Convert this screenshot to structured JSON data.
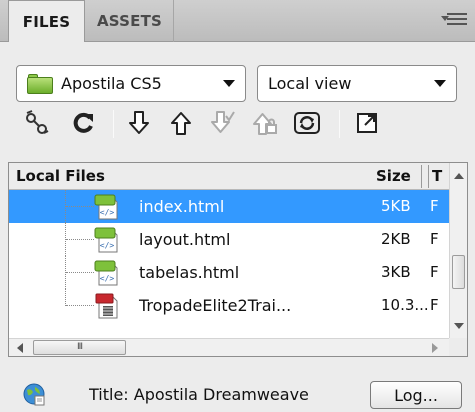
{
  "tabs": [
    {
      "label": "FILES",
      "active": true
    },
    {
      "label": "ASSETS",
      "active": false
    }
  ],
  "site_select": {
    "value": "Apostila CS5",
    "icon": "folder-icon"
  },
  "view_select": {
    "value": "Local view"
  },
  "toolbar": {
    "icons": [
      "connect-icon",
      "refresh-icon",
      "get-icon",
      "put-icon",
      "checkout-icon",
      "checkin-icon",
      "sync-icon",
      "expand-icon"
    ]
  },
  "file_list": {
    "headers": {
      "name": "Local Files",
      "size": "Size",
      "type": "T"
    },
    "rows": [
      {
        "name": "index.html",
        "size": "5KB",
        "type": "F",
        "selected": true,
        "icon": "html-file-icon"
      },
      {
        "name": "layout.html",
        "size": "2KB",
        "type": "F",
        "selected": false,
        "icon": "html-file-icon"
      },
      {
        "name": "tabelas.html",
        "size": "3KB",
        "type": "F",
        "selected": false,
        "icon": "html-file-icon"
      },
      {
        "name": "TropadeElite2Trai...",
        "size": "10.3...",
        "type": "F",
        "selected": false,
        "icon": "video-file-icon"
      }
    ],
    "hscroll_thumb_label": "III"
  },
  "status": {
    "title": "Title: Apostila Dreamweave",
    "log_button": "Log..."
  },
  "colors": {
    "selection": "#3399ff",
    "folder_green": "#6cae2b",
    "panel_bg": "#ececec"
  }
}
